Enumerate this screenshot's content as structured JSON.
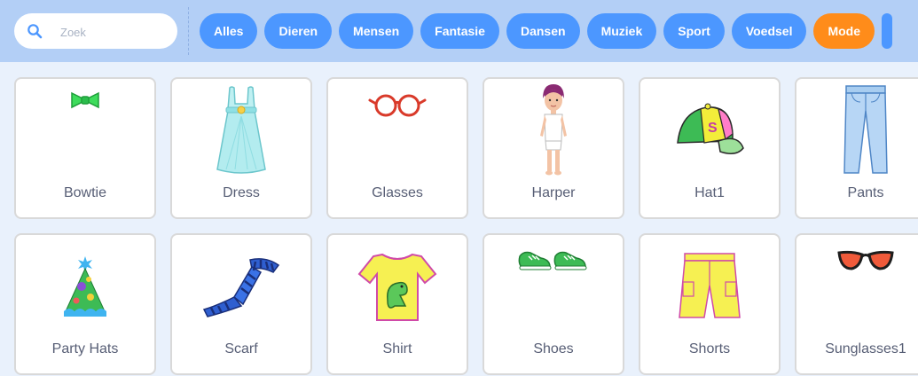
{
  "search": {
    "placeholder": "Zoek",
    "icon": "search-icon"
  },
  "categories": [
    {
      "label": "Alles"
    },
    {
      "label": "Dieren"
    },
    {
      "label": "Mensen"
    },
    {
      "label": "Fantasie"
    },
    {
      "label": "Dansen"
    },
    {
      "label": "Muziek"
    },
    {
      "label": "Sport"
    },
    {
      "label": "Voedsel"
    },
    {
      "label": "Mode",
      "active": true
    }
  ],
  "colors": {
    "topbar": "#b3cff6",
    "category": "#4c97ff",
    "category_active": "#ff8c1a",
    "background": "#e9f1fc",
    "tile_border": "#d9d9d9",
    "text": "#575e75"
  },
  "items": [
    {
      "name": "Bowtie",
      "icon": "bowtie-icon"
    },
    {
      "name": "Dress",
      "icon": "dress-icon"
    },
    {
      "name": "Glasses",
      "icon": "glasses-icon"
    },
    {
      "name": "Harper",
      "icon": "harper-icon"
    },
    {
      "name": "Hat1",
      "icon": "cap-icon"
    },
    {
      "name": "Pants",
      "icon": "pants-icon"
    },
    {
      "name": "Party Hats",
      "icon": "party-hat-icon"
    },
    {
      "name": "Scarf",
      "icon": "scarf-icon"
    },
    {
      "name": "Shirt",
      "icon": "shirt-icon"
    },
    {
      "name": "Shoes",
      "icon": "shoes-icon"
    },
    {
      "name": "Shorts",
      "icon": "shorts-icon"
    },
    {
      "name": "Sunglasses1",
      "icon": "sunglasses-icon"
    }
  ]
}
